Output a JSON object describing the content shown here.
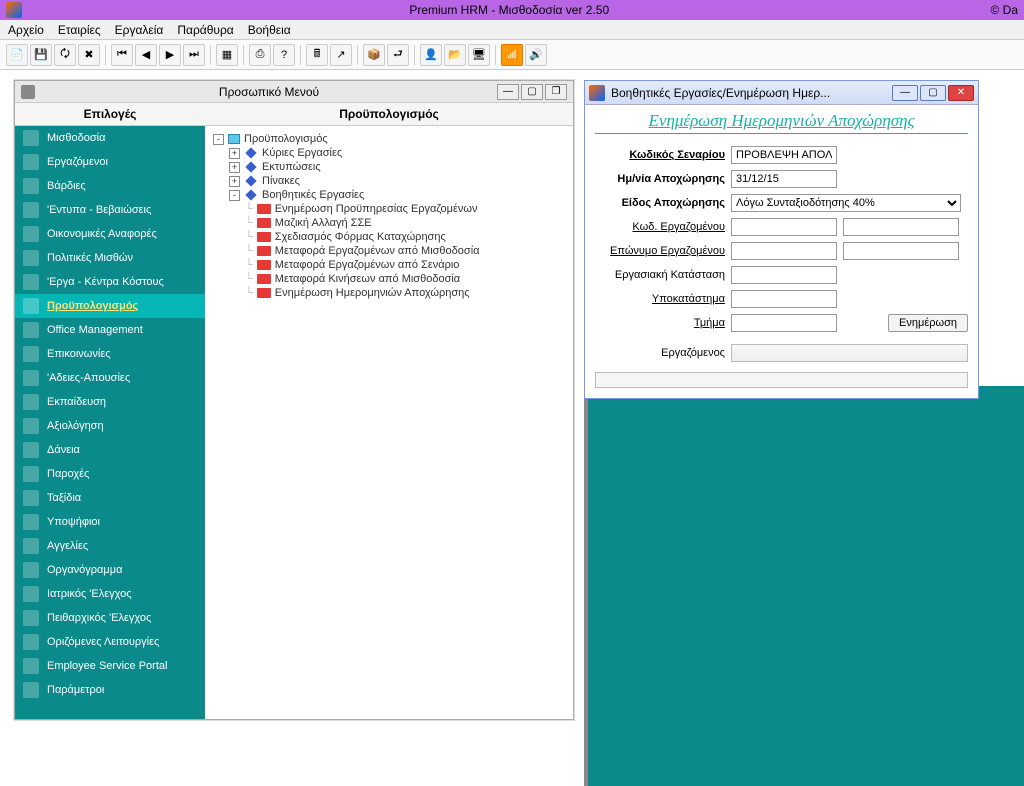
{
  "titlebar": {
    "title": "Premium HRM - Μισθοδοσία ver 2.50",
    "right": "© Da"
  },
  "menubar": [
    "Αρχείο",
    "Εταιρίες",
    "Εργαλεία",
    "Παράθυρα",
    "Βοήθεια"
  ],
  "menuWin": {
    "title": "Προσωπικό Μενού",
    "col1": "Επιλογές",
    "col2": "Προϋπολογισμός"
  },
  "sidebar": {
    "items": [
      {
        "label": "Μισθοδοσία"
      },
      {
        "label": "Εργαζόμενοι"
      },
      {
        "label": "Βάρδιες"
      },
      {
        "label": "'Εντυπα - Βεβαιώσεις"
      },
      {
        "label": "Οικονομικές Αναφορές"
      },
      {
        "label": "Πολιτικές Μισθών"
      },
      {
        "label": "'Εργα - Κέντρα Κόστους"
      },
      {
        "label": "Προϋπολογισμός",
        "active": true
      },
      {
        "label": "Office Management"
      },
      {
        "label": "Επικοινωνίες"
      },
      {
        "label": "'Αδειες-Απουσίες"
      },
      {
        "label": "Εκπαίδευση"
      },
      {
        "label": "Αξιολόγηση"
      },
      {
        "label": "Δάνεια"
      },
      {
        "label": "Παροχές"
      },
      {
        "label": "Ταξίδια"
      },
      {
        "label": "Υποψήφιοι"
      },
      {
        "label": "Αγγελίες"
      },
      {
        "label": "Οργανόγραμμα"
      },
      {
        "label": "Ιατρικός 'Ελεγχος"
      },
      {
        "label": "Πειθαρχικός 'Ελεγχος"
      },
      {
        "label": "Οριζόμενες Λειτουργίες"
      },
      {
        "label": "Employee Service Portal"
      },
      {
        "label": "Παράμετροι"
      }
    ]
  },
  "tree": {
    "root": "Προϋπολογισμός",
    "children": [
      {
        "label": "Κύριες Εργασίες",
        "exp": "+"
      },
      {
        "label": "Εκτυπώσεις",
        "exp": "+"
      },
      {
        "label": "Πίνακες",
        "exp": "+"
      },
      {
        "label": "Βοηθητικές Εργασίες",
        "exp": "-",
        "children": [
          {
            "label": "Ενημέρωση Προϋπηρεσίας Εργαζομένων"
          },
          {
            "label": "Μαζική Αλλαγή ΣΣΕ"
          },
          {
            "label": "Σχεδιασμός Φόρμας Καταχώρησης"
          },
          {
            "label": "Μεταφορά Εργαζομένων από Μισθοδοσία"
          },
          {
            "label": "Μεταφορά Εργαζομένων από Σενάριο"
          },
          {
            "label": "Μεταφορά Κινήσεων από Μισθοδοσία"
          },
          {
            "label": "Ενημέρωση Ημερομηνιών Αποχώρησης"
          }
        ]
      }
    ]
  },
  "dialog": {
    "winTitle": "Βοηθητικές Εργασίες/Ενημέρωση Ημερ...",
    "heading": "Ενημέρωση Ημερομηνιών Αποχώρησης",
    "labels": {
      "scenario": "Κωδικός Σεναρίου",
      "date": "Ημ/νία Αποχώρησης",
      "type": "Είδος Αποχώρησης",
      "empCode": "Κωδ. Εργαζομένου",
      "empName": "Επώνυμο Εργαζομένου",
      "workStatus": "Εργασιακή Κατάσταση",
      "branch": "Υποκατάστημα",
      "dept": "Τμήμα",
      "update": "Ενημέρωση",
      "employee": "Εργαζόμενος"
    },
    "values": {
      "scenario": "ΠΡΟΒΛΕΨΗ ΑΠΟΛΥΣΗΣ",
      "date": "31/12/15",
      "type": "Λόγω Συνταξιοδότησης 40%"
    }
  }
}
